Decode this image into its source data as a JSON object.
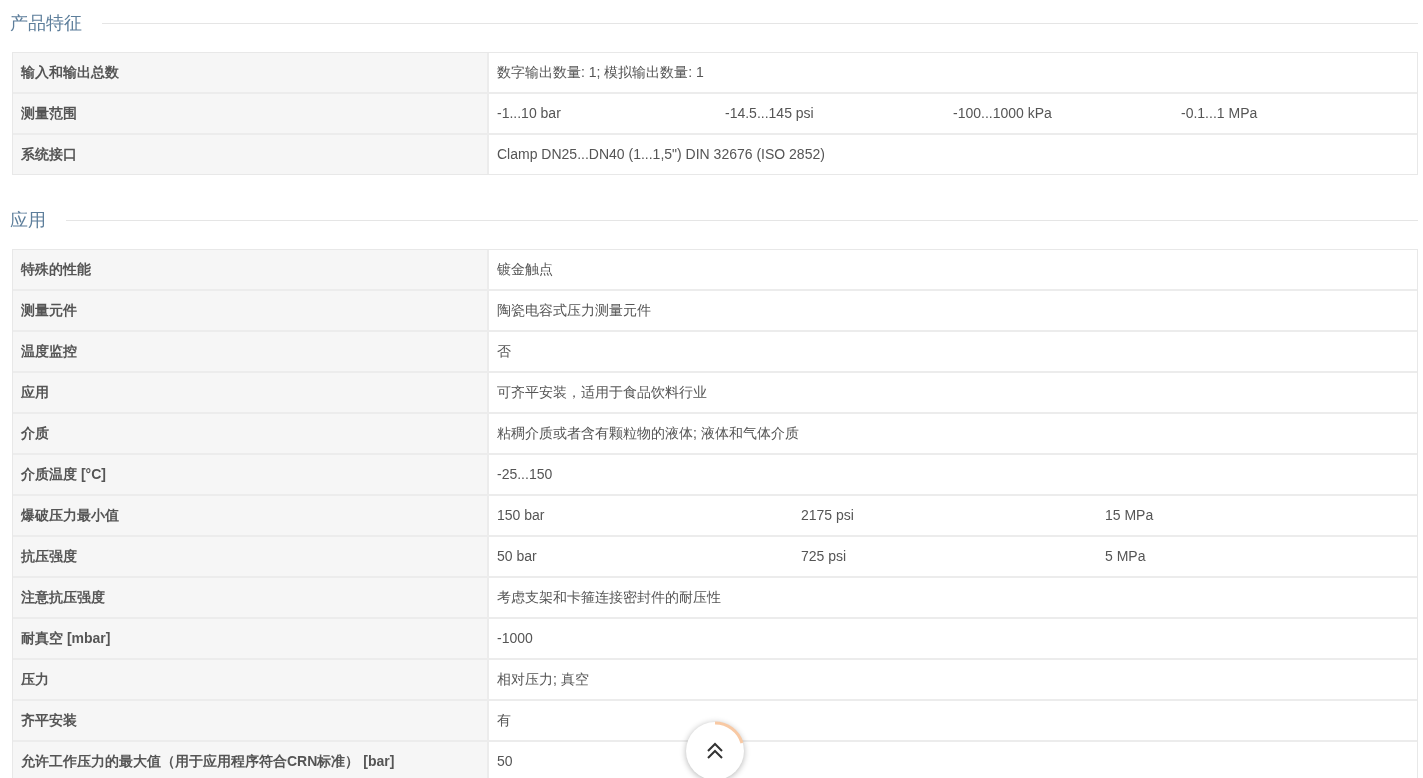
{
  "sections": [
    {
      "title": "产品特征",
      "rows": [
        {
          "label": "输入和输出总数",
          "values": [
            "数字输出数量: 1; 模拟输出数量: 1"
          ]
        },
        {
          "label": "测量范围",
          "values": [
            "-1...10 bar",
            "-14.5...145 psi",
            "-100...1000 kPa",
            "-0.1...1 MPa"
          ]
        },
        {
          "label": "系统接口",
          "values": [
            "Clamp DN25...DN40 (1...1,5\") DIN 32676 (ISO 2852)"
          ]
        }
      ]
    },
    {
      "title": "应用",
      "rows": [
        {
          "label": "特殊的性能",
          "values": [
            "镀金触点"
          ]
        },
        {
          "label": "测量元件",
          "values": [
            "陶瓷电容式压力测量元件"
          ]
        },
        {
          "label": "温度监控",
          "values": [
            "否"
          ]
        },
        {
          "label": "应用",
          "values": [
            "可齐平安装，适用于食品饮料行业"
          ]
        },
        {
          "label": "介质",
          "values": [
            "粘稠介质或者含有颗粒物的液体; 液体和气体介质"
          ]
        },
        {
          "label": "介质温度 [°C]",
          "values": [
            "-25...150"
          ]
        },
        {
          "label": "爆破压力最小值",
          "values": [
            "150 bar",
            "2175 psi",
            "15 MPa"
          ]
        },
        {
          "label": "抗压强度",
          "values": [
            "50 bar",
            "725 psi",
            "5 MPa"
          ]
        },
        {
          "label": "注意抗压强度",
          "values": [
            "考虑支架和卡箍连接密封件的耐压性"
          ]
        },
        {
          "label": "耐真空 [mbar]",
          "values": [
            "-1000"
          ]
        },
        {
          "label": "压力",
          "values": [
            "相对压力; 真空"
          ]
        },
        {
          "label": "齐平安装",
          "values": [
            "有"
          ]
        },
        {
          "label": "允许工作压力的最大值（用于应用程序符合CRN标准） [bar]",
          "values": [
            "50"
          ]
        }
      ]
    }
  ]
}
